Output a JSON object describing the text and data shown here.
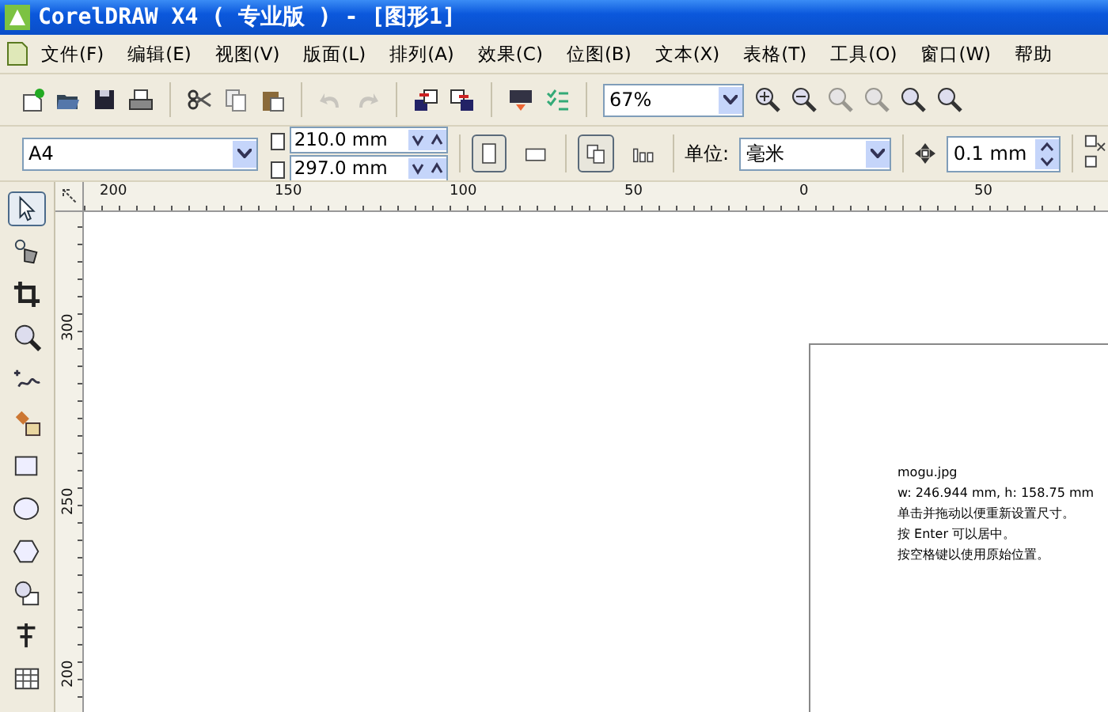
{
  "window": {
    "title": "CorelDRAW X4 ( 专业版 ) - [图形1]"
  },
  "menu": [
    {
      "label": "文件(F)"
    },
    {
      "label": "编辑(E)"
    },
    {
      "label": "视图(V)"
    },
    {
      "label": "版面(L)"
    },
    {
      "label": "排列(A)"
    },
    {
      "label": "效果(C)"
    },
    {
      "label": "位图(B)"
    },
    {
      "label": "文本(X)"
    },
    {
      "label": "表格(T)"
    },
    {
      "label": "工具(O)"
    },
    {
      "label": "窗口(W)"
    },
    {
      "label": "帮助"
    }
  ],
  "toolbar": {
    "buttons": [
      {
        "disabled": false
      },
      {
        "disabled": false
      },
      {
        "disabled": false
      },
      {
        "disabled": false
      },
      {
        "disabled": false
      },
      {
        "disabled": false
      },
      {
        "disabled": false
      },
      {
        "disabled": true
      },
      {
        "disabled": true
      },
      {
        "disabled": false
      },
      {
        "disabled": false
      },
      {
        "disabled": false
      },
      {
        "disabled": false
      }
    ],
    "zoom": "67%",
    "zoom_buttons": [
      {
        "disabled": false
      },
      {
        "disabled": false
      },
      {
        "disabled": true
      },
      {
        "disabled": true
      },
      {
        "disabled": false
      },
      {
        "disabled": false
      }
    ]
  },
  "property_bar": {
    "paper_size": "A4",
    "width": "210.0 mm",
    "height": "297.0 mm",
    "orientation": [
      {
        "selected": true
      },
      {
        "selected": false
      }
    ],
    "pages": [
      {
        "selected": true
      },
      {
        "selected": false
      }
    ],
    "units_label": "单位:",
    "units": "毫米",
    "nudge": "0.1 mm"
  },
  "ruler_h": [
    "200",
    "150",
    "100",
    "50",
    "0",
    "50"
  ],
  "ruler_v": [
    "300",
    "250",
    "200"
  ],
  "toolbox": [
    {
      "selected": true
    },
    {
      "selected": false
    },
    {
      "selected": false
    },
    {
      "selected": false
    },
    {
      "selected": false
    },
    {
      "selected": false
    },
    {
      "selected": false
    },
    {
      "selected": false
    },
    {
      "selected": false
    },
    {
      "selected": false
    },
    {
      "selected": false
    },
    {
      "selected": false
    }
  ],
  "hint": {
    "lines": [
      "mogu.jpg",
      "w: 246.944 mm, h: 158.75 mm",
      "单击并拖动以便重新设置尺寸。",
      "按 Enter 可以居中。",
      "按空格键以使用原始位置。"
    ]
  }
}
